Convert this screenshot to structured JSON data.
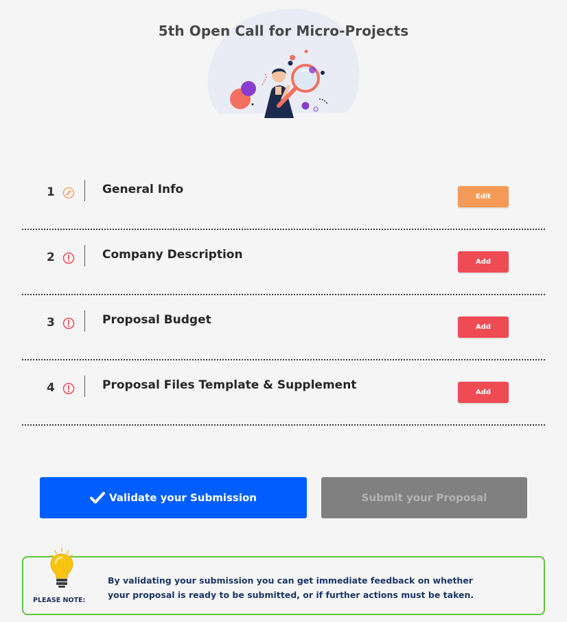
{
  "page": {
    "title": "5th Open Call for Micro-Projects"
  },
  "steps": [
    {
      "number": "1",
      "label": "General Info",
      "status_icon": "edit-pencil-icon",
      "button_label": "Edit",
      "button_color": "#f59a56"
    },
    {
      "number": "2",
      "label": "Company Description",
      "status_icon": "warning-circle-icon",
      "button_label": "Add",
      "button_color": "#ef4b55"
    },
    {
      "number": "3",
      "label": "Proposal Budget",
      "status_icon": "warning-circle-icon",
      "button_label": "Add",
      "button_color": "#ef4b55"
    },
    {
      "number": "4",
      "label": "Proposal Files Template & Supplement",
      "status_icon": "warning-circle-icon",
      "button_label": "Add",
      "button_color": "#ef4b55"
    }
  ],
  "actions": {
    "validate_label": "Validate your Submission",
    "submit_label": "Submit your Proposal",
    "validate_color": "#005eff",
    "submit_color": "#808080"
  },
  "note": {
    "label": "PLEASE NOTE:",
    "text": "By validating your submission you can get immediate feedback on whether your proposal is ready to be submitted, or if further actions must be taken.",
    "border_color": "#5cc93a"
  }
}
